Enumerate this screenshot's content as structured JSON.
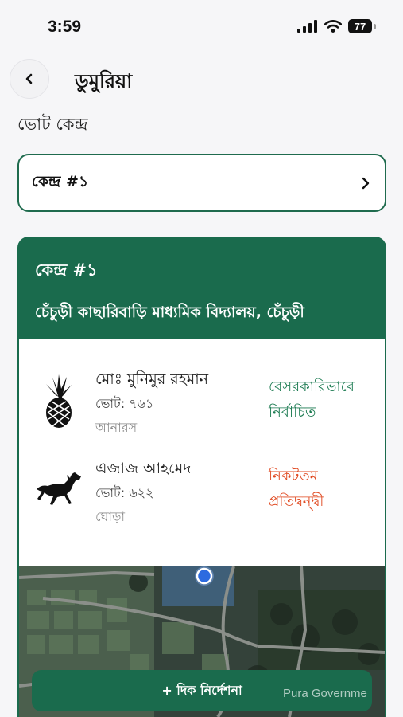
{
  "status_bar": {
    "time": "3:59",
    "battery": "77"
  },
  "header": {
    "title": "ডুমুরিয়া"
  },
  "section": {
    "label": "ভোট কেন্দ্র"
  },
  "center_select": {
    "value": "কেন্দ্র #১"
  },
  "card": {
    "title": "কেন্দ্র #১",
    "subtitle": "চেঁচুড়ী কাছারিবাড়ি মাধ্যমিক বিদ্যালয়, চেঁচুড়ী",
    "candidates": [
      {
        "name": "মোঃ মুনিমুর রহমান",
        "votes": "ভোট: ৭৬১",
        "symbol": "আনারস",
        "symbol_icon": "pineapple-icon",
        "status": "বেসরকারিভাবে নির্বাচিত",
        "status_color": "#1a7a50"
      },
      {
        "name": "এজাজ আহমেদ",
        "votes": "ভোট: ৬২২",
        "symbol": "ঘোড়া",
        "symbol_icon": "horse-icon",
        "status": "নিকটতম প্রতিদ্বন্দ্বী",
        "status_color": "#e0481f"
      }
    ]
  },
  "map": {
    "attribution": "Pura Governme"
  },
  "directions_button": {
    "label": "+ দিক নির্দেশনা"
  },
  "colors": {
    "primary": "#1a6b4d",
    "elected": "#1a7a50",
    "runner_up": "#e0481f"
  }
}
